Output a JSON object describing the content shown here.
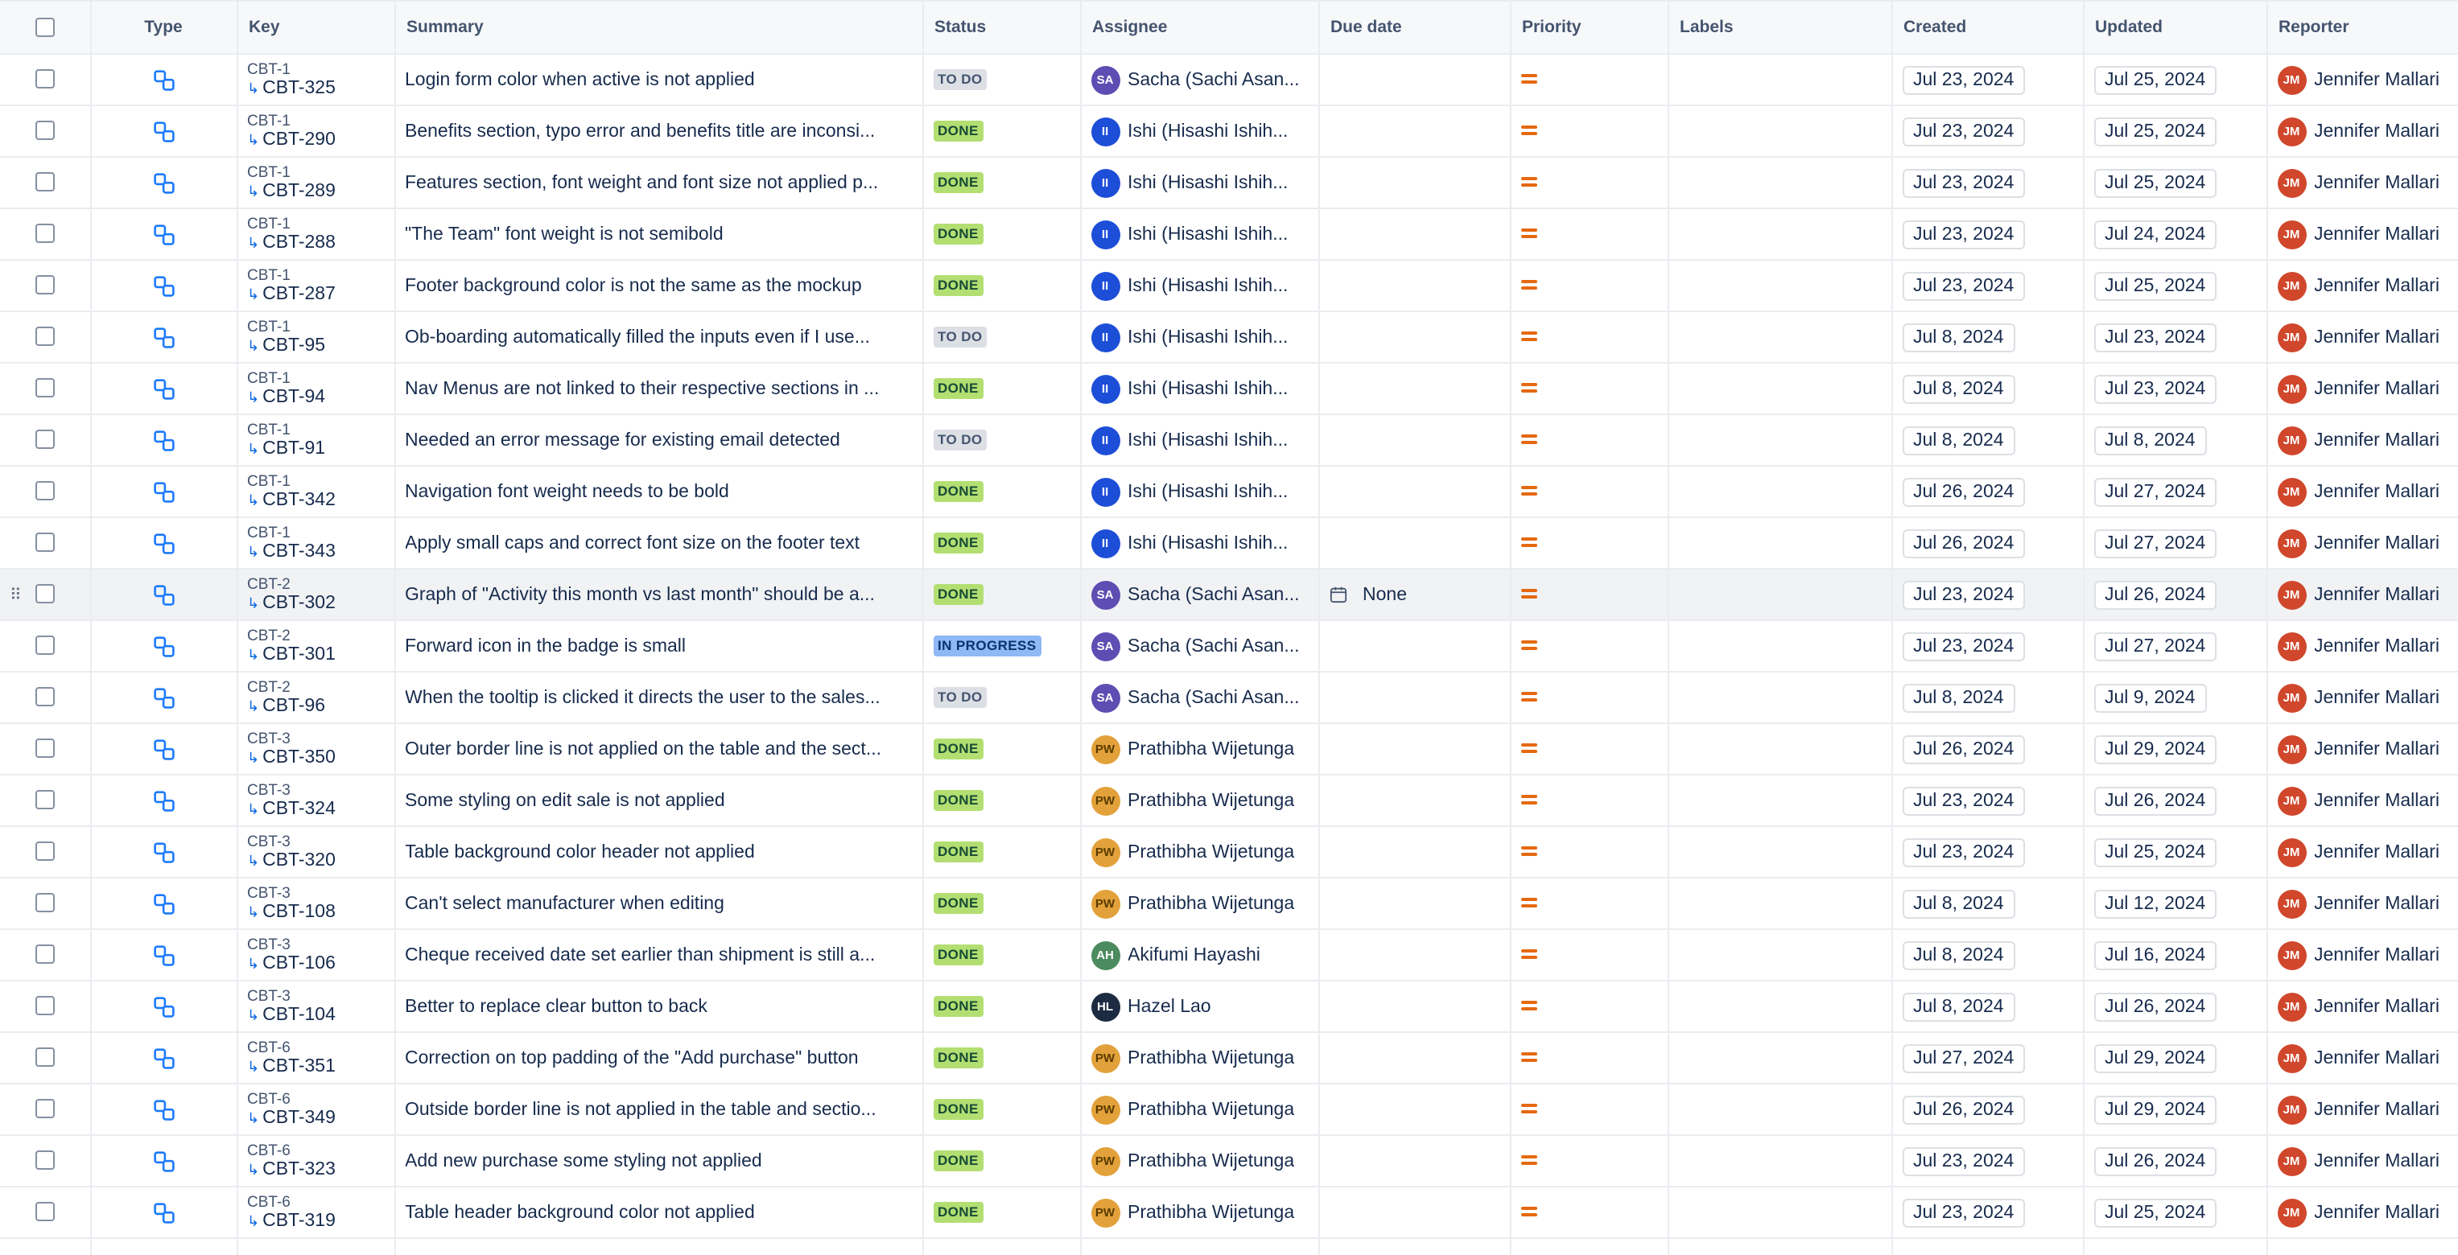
{
  "columns": {
    "type": "Type",
    "key": "Key",
    "summary": "Summary",
    "status": "Status",
    "assignee": "Assignee",
    "due": "Due date",
    "priority": "Priority",
    "labels": "Labels",
    "created": "Created",
    "updated": "Updated",
    "reporter": "Reporter"
  },
  "type_icon": "subtask-icon",
  "priority_icon": "priority-medium-icon",
  "colors": {
    "done": "#b3df72",
    "todo": "#dcdfe4",
    "in_progress": "#8fb8f6",
    "priority": "#e56910"
  },
  "hover_due": "None",
  "rows": [
    {
      "parent": "CBT-1",
      "key": "CBT-325",
      "summary": "Login form color when active is not applied",
      "status": "TO DO",
      "assignee": "Sacha (Sachi Asan...",
      "initials": "SA",
      "created": "Jul 23, 2024",
      "updated": "Jul 25, 2024",
      "reporter": "Jennifer Mallari",
      "rep_initials": "JM"
    },
    {
      "parent": "CBT-1",
      "key": "CBT-290",
      "summary": "Benefits section, typo error and benefits title are inconsi...",
      "status": "DONE",
      "assignee": "Ishi (Hisashi Ishih...",
      "initials": "II",
      "created": "Jul 23, 2024",
      "updated": "Jul 25, 2024",
      "reporter": "Jennifer Mallari",
      "rep_initials": "JM"
    },
    {
      "parent": "CBT-1",
      "key": "CBT-289",
      "summary": "Features section, font weight and font size not applied p...",
      "status": "DONE",
      "assignee": "Ishi (Hisashi Ishih...",
      "initials": "II",
      "created": "Jul 23, 2024",
      "updated": "Jul 25, 2024",
      "reporter": "Jennifer Mallari",
      "rep_initials": "JM"
    },
    {
      "parent": "CBT-1",
      "key": "CBT-288",
      "summary": "\"The Team\" font weight is not semibold",
      "status": "DONE",
      "assignee": "Ishi (Hisashi Ishih...",
      "initials": "II",
      "created": "Jul 23, 2024",
      "updated": "Jul 24, 2024",
      "reporter": "Jennifer Mallari",
      "rep_initials": "JM"
    },
    {
      "parent": "CBT-1",
      "key": "CBT-287",
      "summary": "Footer background color is not the same as the mockup",
      "status": "DONE",
      "assignee": "Ishi (Hisashi Ishih...",
      "initials": "II",
      "created": "Jul 23, 2024",
      "updated": "Jul 25, 2024",
      "reporter": "Jennifer Mallari",
      "rep_initials": "JM"
    },
    {
      "parent": "CBT-1",
      "key": "CBT-95",
      "summary": "Ob-boarding automatically filled the inputs even if I use...",
      "status": "TO DO",
      "assignee": "Ishi (Hisashi Ishih...",
      "initials": "II",
      "created": "Jul 8, 2024",
      "updated": "Jul 23, 2024",
      "reporter": "Jennifer Mallari",
      "rep_initials": "JM"
    },
    {
      "parent": "CBT-1",
      "key": "CBT-94",
      "summary": "Nav Menus are not linked to their respective sections in ...",
      "status": "DONE",
      "assignee": "Ishi (Hisashi Ishih...",
      "initials": "II",
      "created": "Jul 8, 2024",
      "updated": "Jul 23, 2024",
      "reporter": "Jennifer Mallari",
      "rep_initials": "JM"
    },
    {
      "parent": "CBT-1",
      "key": "CBT-91",
      "summary": "Needed an error message for existing email detected",
      "status": "TO DO",
      "assignee": "Ishi (Hisashi Ishih...",
      "initials": "II",
      "created": "Jul 8, 2024",
      "updated": "Jul 8, 2024",
      "reporter": "Jennifer Mallari",
      "rep_initials": "JM"
    },
    {
      "parent": "CBT-1",
      "key": "CBT-342",
      "summary": "Navigation font weight needs to be bold",
      "status": "DONE",
      "assignee": "Ishi (Hisashi Ishih...",
      "initials": "II",
      "created": "Jul 26, 2024",
      "updated": "Jul 27, 2024",
      "reporter": "Jennifer Mallari",
      "rep_initials": "JM"
    },
    {
      "parent": "CBT-1",
      "key": "CBT-343",
      "summary": "Apply small caps and correct font size on the footer text",
      "status": "DONE",
      "assignee": "Ishi (Hisashi Ishih...",
      "initials": "II",
      "created": "Jul 26, 2024",
      "updated": "Jul 27, 2024",
      "reporter": "Jennifer Mallari",
      "rep_initials": "JM"
    },
    {
      "parent": "CBT-2",
      "key": "CBT-302",
      "summary": "Graph of \"Activity this month vs last month\" should be a...",
      "status": "DONE",
      "assignee": "Sacha (Sachi Asan...",
      "initials": "SA",
      "created": "Jul 23, 2024",
      "updated": "Jul 26, 2024",
      "reporter": "Jennifer Mallari",
      "rep_initials": "JM",
      "hovered": true
    },
    {
      "parent": "CBT-2",
      "key": "CBT-301",
      "summary": "Forward icon in the badge is small",
      "status": "IN PROGRESS",
      "assignee": "Sacha (Sachi Asan...",
      "initials": "SA",
      "created": "Jul 23, 2024",
      "updated": "Jul 27, 2024",
      "reporter": "Jennifer Mallari",
      "rep_initials": "JM"
    },
    {
      "parent": "CBT-2",
      "key": "CBT-96",
      "summary": "When the tooltip is clicked it directs the user to the sales...",
      "status": "TO DO",
      "assignee": "Sacha (Sachi Asan...",
      "initials": "SA",
      "created": "Jul 8, 2024",
      "updated": "Jul 9, 2024",
      "reporter": "Jennifer Mallari",
      "rep_initials": "JM"
    },
    {
      "parent": "CBT-3",
      "key": "CBT-350",
      "summary": "Outer border line is not applied on the table and the sect...",
      "status": "DONE",
      "assignee": "Prathibha Wijetunga",
      "initials": "PW",
      "created": "Jul 26, 2024",
      "updated": "Jul 29, 2024",
      "reporter": "Jennifer Mallari",
      "rep_initials": "JM"
    },
    {
      "parent": "CBT-3",
      "key": "CBT-324",
      "summary": "Some styling on edit sale is not applied",
      "status": "DONE",
      "assignee": "Prathibha Wijetunga",
      "initials": "PW",
      "created": "Jul 23, 2024",
      "updated": "Jul 26, 2024",
      "reporter": "Jennifer Mallari",
      "rep_initials": "JM"
    },
    {
      "parent": "CBT-3",
      "key": "CBT-320",
      "summary": "Table background color header not applied",
      "status": "DONE",
      "assignee": "Prathibha Wijetunga",
      "initials": "PW",
      "created": "Jul 23, 2024",
      "updated": "Jul 25, 2024",
      "reporter": "Jennifer Mallari",
      "rep_initials": "JM"
    },
    {
      "parent": "CBT-3",
      "key": "CBT-108",
      "summary": "Can't select manufacturer when editing",
      "status": "DONE",
      "assignee": "Prathibha Wijetunga",
      "initials": "PW",
      "created": "Jul 8, 2024",
      "updated": "Jul 12, 2024",
      "reporter": "Jennifer Mallari",
      "rep_initials": "JM"
    },
    {
      "parent": "CBT-3",
      "key": "CBT-106",
      "summary": "Cheque received date set earlier than shipment is still a...",
      "status": "DONE",
      "assignee": "Akifumi Hayashi",
      "initials": "AH",
      "created": "Jul 8, 2024",
      "updated": "Jul 16, 2024",
      "reporter": "Jennifer Mallari",
      "rep_initials": "JM"
    },
    {
      "parent": "CBT-3",
      "key": "CBT-104",
      "summary": "Better to replace clear button to back",
      "status": "DONE",
      "assignee": "Hazel Lao",
      "initials": "HL",
      "created": "Jul 8, 2024",
      "updated": "Jul 26, 2024",
      "reporter": "Jennifer Mallari",
      "rep_initials": "JM"
    },
    {
      "parent": "CBT-6",
      "key": "CBT-351",
      "summary": "Correction on top padding of the \"Add purchase\" button",
      "status": "DONE",
      "assignee": "Prathibha Wijetunga",
      "initials": "PW",
      "created": "Jul 27, 2024",
      "updated": "Jul 29, 2024",
      "reporter": "Jennifer Mallari",
      "rep_initials": "JM"
    },
    {
      "parent": "CBT-6",
      "key": "CBT-349",
      "summary": "Outside border line is not applied in the table and sectio...",
      "status": "DONE",
      "assignee": "Prathibha Wijetunga",
      "initials": "PW",
      "created": "Jul 26, 2024",
      "updated": "Jul 29, 2024",
      "reporter": "Jennifer Mallari",
      "rep_initials": "JM"
    },
    {
      "parent": "CBT-6",
      "key": "CBT-323",
      "summary": "Add new purchase some styling not applied",
      "status": "DONE",
      "assignee": "Prathibha Wijetunga",
      "initials": "PW",
      "created": "Jul 23, 2024",
      "updated": "Jul 26, 2024",
      "reporter": "Jennifer Mallari",
      "rep_initials": "JM"
    },
    {
      "parent": "CBT-6",
      "key": "CBT-319",
      "summary": "Table header background color not applied",
      "status": "DONE",
      "assignee": "Prathibha Wijetunga",
      "initials": "PW",
      "created": "Jul 23, 2024",
      "updated": "Jul 25, 2024",
      "reporter": "Jennifer Mallari",
      "rep_initials": "JM"
    }
  ]
}
